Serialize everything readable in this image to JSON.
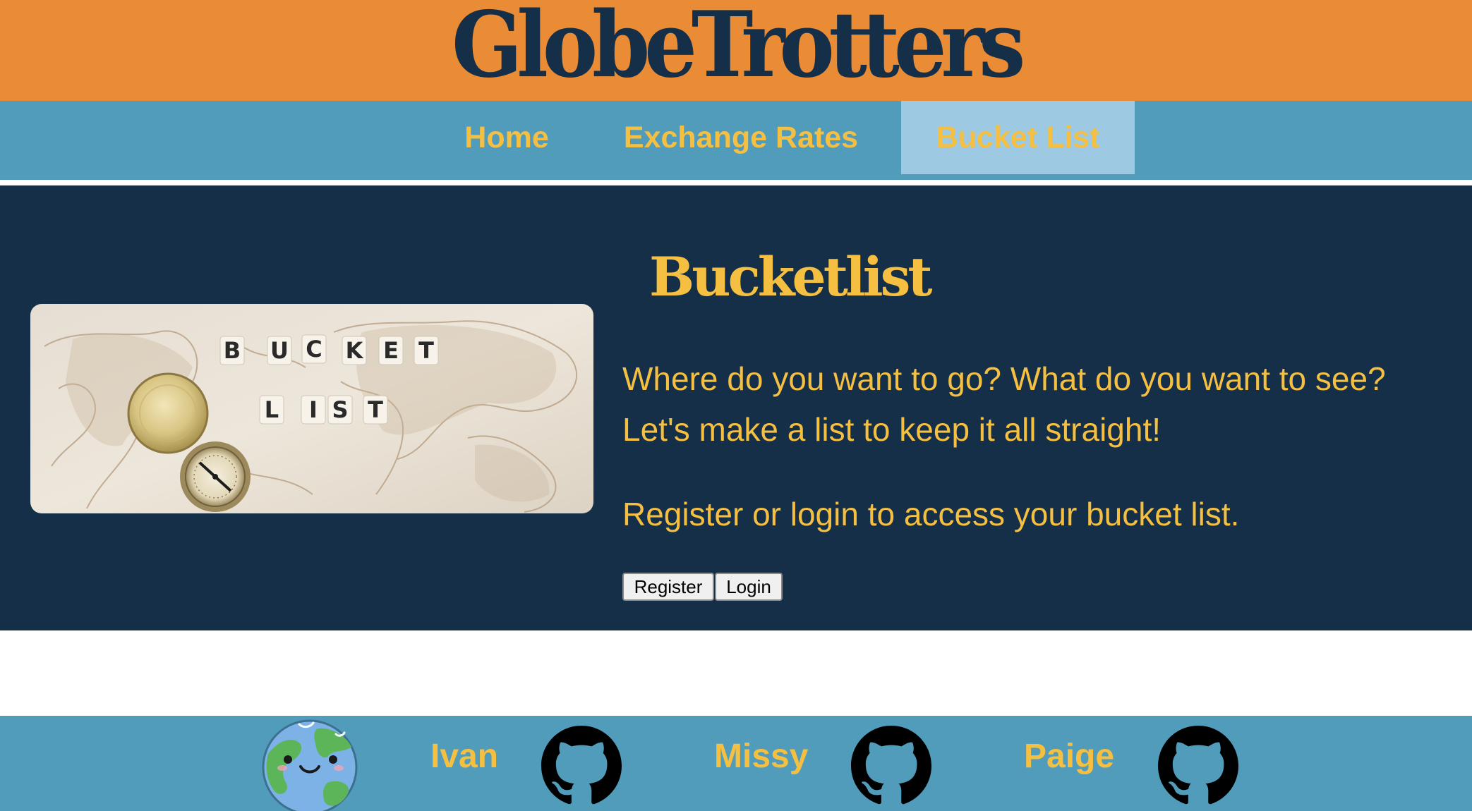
{
  "header": {
    "site_title": "GlobeTrotters"
  },
  "nav": {
    "items": [
      {
        "label": "Home",
        "active": false
      },
      {
        "label": "Exchange Rates",
        "active": false
      },
      {
        "label": "Bucket List",
        "active": true
      }
    ]
  },
  "main": {
    "image_tiles": {
      "row1": [
        "B",
        "U",
        "C",
        "K",
        "E",
        "T"
      ],
      "row2": [
        "L",
        "I",
        "S",
        "T"
      ]
    },
    "title": "Bucketlist",
    "intro": "Where do you want to go? What do you want to see? Let's make a list to keep it all straight!",
    "login_prompt": "Register or login to access your bucket list.",
    "register_label": "Register",
    "login_label": "Login"
  },
  "footer": {
    "members": [
      {
        "name": "Ivan",
        "icon": "github-icon"
      },
      {
        "name": "Missy",
        "icon": "github-icon"
      },
      {
        "name": "Paige",
        "icon": "github-icon"
      }
    ],
    "logo_icon": "globe-icon"
  },
  "colors": {
    "header_bg": "#EA8B36",
    "nav_bg": "#519CBB",
    "nav_active_bg": "#9DCAE2",
    "main_bg": "#142F47",
    "accent_text": "#F5BF41",
    "title_text": "#142F47"
  }
}
